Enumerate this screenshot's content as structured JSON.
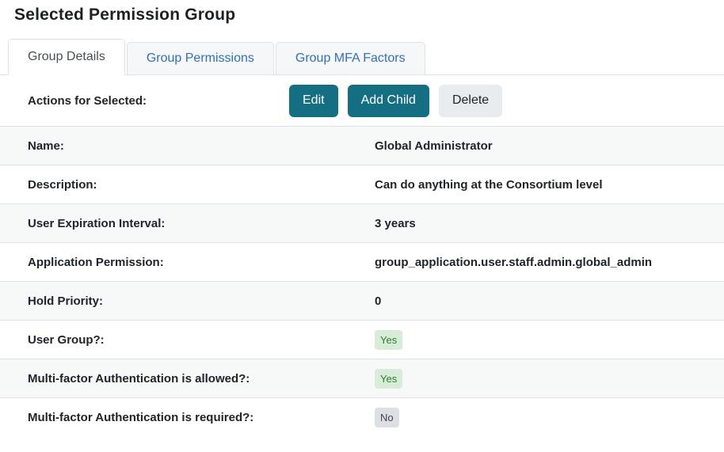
{
  "page": {
    "title": "Selected Permission Group"
  },
  "tabs": [
    {
      "label": "Group Details",
      "active": true
    },
    {
      "label": "Group Permissions",
      "active": false
    },
    {
      "label": "Group MFA Factors",
      "active": false
    }
  ],
  "actions": {
    "label": "Actions for Selected:",
    "buttons": [
      {
        "label": "Edit",
        "variant": "teal"
      },
      {
        "label": "Add Child",
        "variant": "teal"
      },
      {
        "label": "Delete",
        "variant": "light"
      }
    ]
  },
  "details": {
    "rows": [
      {
        "label": "Name:",
        "value": "Global Administrator",
        "type": "text"
      },
      {
        "label": "Description:",
        "value": "Can do anything at the Consortium level",
        "type": "text"
      },
      {
        "label": "User Expiration Interval:",
        "value": "3 years",
        "type": "text"
      },
      {
        "label": "Application Permission:",
        "value": "group_application.user.staff.admin.global_admin",
        "type": "text"
      },
      {
        "label": "Hold Priority:",
        "value": "0",
        "type": "text"
      },
      {
        "label": "User Group?:",
        "value": "Yes",
        "type": "badge",
        "badge_color": "green"
      },
      {
        "label": "Multi-factor Authentication is allowed?:",
        "value": "Yes",
        "type": "badge",
        "badge_color": "green"
      },
      {
        "label": "Multi-factor Authentication is required?:",
        "value": "No",
        "type": "badge",
        "badge_color": "gray"
      }
    ]
  },
  "colors": {
    "button_teal": "#156f83",
    "button_light_bg": "#e9ecef",
    "tab_link_blue": "#2f70c0",
    "active_tab_text": "#495057",
    "badge_yes_bg": "#d8edd8",
    "badge_yes_text": "#2e7d32",
    "badge_no_bg": "#dcdfe3",
    "badge_no_text": "#40464c",
    "row_alt_bg": "#f7f8f8",
    "border": "#dee2e6"
  }
}
